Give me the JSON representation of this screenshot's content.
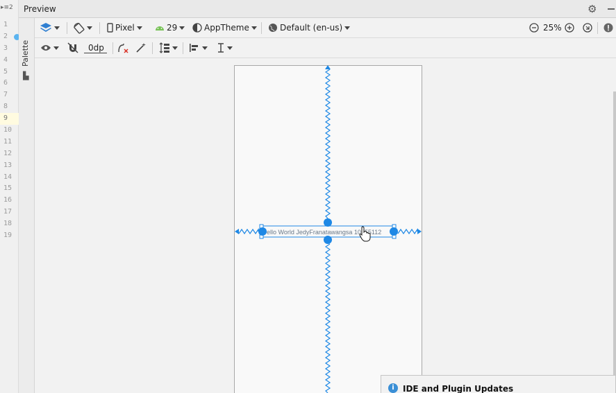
{
  "gutter": {
    "top_label": "▸≡2",
    "line_numbers": [
      "1",
      "2",
      "3",
      "4",
      "5",
      "6",
      "7",
      "8",
      "9",
      "10",
      "11",
      "12",
      "13",
      "14",
      "15",
      "16",
      "17",
      "18",
      "19"
    ]
  },
  "palette": {
    "label": "Palette"
  },
  "window": {
    "title": "Preview"
  },
  "toolbar1": {
    "device": "Pixel",
    "api_level": "29",
    "theme": "AppTheme",
    "locale": "Default (en-us)",
    "zoom": "25%"
  },
  "toolbar2": {
    "default_margin": "0dp"
  },
  "canvas": {
    "textview_text": "ello World JedyFranatawangsa 10555112"
  },
  "notification": {
    "title": "IDE and Plugin Updates",
    "icon": "i"
  },
  "colors": {
    "constraint_blue": "#1e88e5",
    "accent": "#3a8fd6"
  }
}
